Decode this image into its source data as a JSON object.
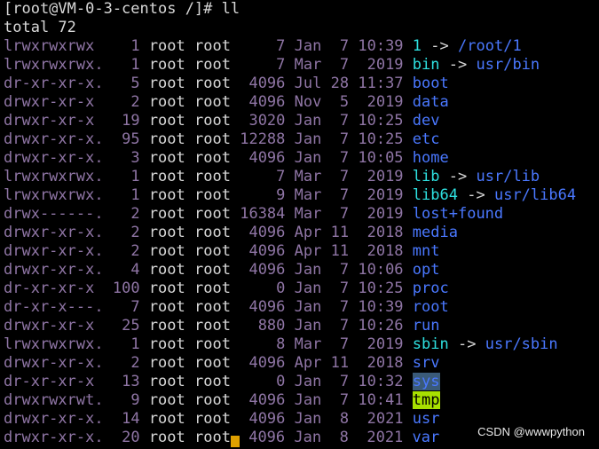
{
  "prompt": "[root@VM-0-3-centos /]# ll",
  "total": "total 72",
  "colors": {
    "perm": "#8f75a5",
    "dir": "#4a78ff",
    "link": "#2ee0e0",
    "highlight_sys": "#3a5a78",
    "highlight_tmp": "#a8e000",
    "cursor": "#e0a000"
  },
  "rows": [
    {
      "perm": "lrwxrwxrwx ",
      "links": "  1",
      "owner": "root",
      "group": "root",
      "size": "    7",
      "month": "Jan",
      "day": " 7",
      "time": "10:39",
      "name": "1",
      "kind": "link",
      "target": "/root/1"
    },
    {
      "perm": "lrwxrwxrwx.",
      "links": "  1",
      "owner": "root",
      "group": "root",
      "size": "    7",
      "month": "Mar",
      "day": " 7",
      "time": " 2019",
      "name": "bin",
      "kind": "link",
      "target": "usr/bin"
    },
    {
      "perm": "dr-xr-xr-x.",
      "links": "  5",
      "owner": "root",
      "group": "root",
      "size": " 4096",
      "month": "Jul",
      "day": "28",
      "time": "11:37",
      "name": "boot",
      "kind": "dir",
      "target": ""
    },
    {
      "perm": "drwxr-xr-x ",
      "links": "  2",
      "owner": "root",
      "group": "root",
      "size": " 4096",
      "month": "Nov",
      "day": " 5",
      "time": " 2019",
      "name": "data",
      "kind": "dir",
      "target": ""
    },
    {
      "perm": "drwxr-xr-x ",
      "links": " 19",
      "owner": "root",
      "group": "root",
      "size": " 3020",
      "month": "Jan",
      "day": " 7",
      "time": "10:25",
      "name": "dev",
      "kind": "dir",
      "target": ""
    },
    {
      "perm": "drwxr-xr-x.",
      "links": " 95",
      "owner": "root",
      "group": "root",
      "size": "12288",
      "month": "Jan",
      "day": " 7",
      "time": "10:25",
      "name": "etc",
      "kind": "dir",
      "target": ""
    },
    {
      "perm": "drwxr-xr-x.",
      "links": "  3",
      "owner": "root",
      "group": "root",
      "size": " 4096",
      "month": "Jan",
      "day": " 7",
      "time": "10:05",
      "name": "home",
      "kind": "dir",
      "target": ""
    },
    {
      "perm": "lrwxrwxrwx.",
      "links": "  1",
      "owner": "root",
      "group": "root",
      "size": "    7",
      "month": "Mar",
      "day": " 7",
      "time": " 2019",
      "name": "lib",
      "kind": "link",
      "target": "usr/lib"
    },
    {
      "perm": "lrwxrwxrwx.",
      "links": "  1",
      "owner": "root",
      "group": "root",
      "size": "    9",
      "month": "Mar",
      "day": " 7",
      "time": " 2019",
      "name": "lib64",
      "kind": "link",
      "target": "usr/lib64"
    },
    {
      "perm": "drwx------.",
      "links": "  2",
      "owner": "root",
      "group": "root",
      "size": "16384",
      "month": "Mar",
      "day": " 7",
      "time": " 2019",
      "name": "lost+found",
      "kind": "dir",
      "target": ""
    },
    {
      "perm": "drwxr-xr-x.",
      "links": "  2",
      "owner": "root",
      "group": "root",
      "size": " 4096",
      "month": "Apr",
      "day": "11",
      "time": " 2018",
      "name": "media",
      "kind": "dir",
      "target": ""
    },
    {
      "perm": "drwxr-xr-x.",
      "links": "  2",
      "owner": "root",
      "group": "root",
      "size": " 4096",
      "month": "Apr",
      "day": "11",
      "time": " 2018",
      "name": "mnt",
      "kind": "dir",
      "target": ""
    },
    {
      "perm": "drwxr-xr-x.",
      "links": "  4",
      "owner": "root",
      "group": "root",
      "size": " 4096",
      "month": "Jan",
      "day": " 7",
      "time": "10:06",
      "name": "opt",
      "kind": "dir",
      "target": ""
    },
    {
      "perm": "dr-xr-xr-x ",
      "links": "100",
      "owner": "root",
      "group": "root",
      "size": "    0",
      "month": "Jan",
      "day": " 7",
      "time": "10:25",
      "name": "proc",
      "kind": "dir",
      "target": ""
    },
    {
      "perm": "dr-xr-x---.",
      "links": "  7",
      "owner": "root",
      "group": "root",
      "size": " 4096",
      "month": "Jan",
      "day": " 7",
      "time": "10:39",
      "name": "root",
      "kind": "dir",
      "target": ""
    },
    {
      "perm": "drwxr-xr-x ",
      "links": " 25",
      "owner": "root",
      "group": "root",
      "size": "  880",
      "month": "Jan",
      "day": " 7",
      "time": "10:26",
      "name": "run",
      "kind": "dir",
      "target": ""
    },
    {
      "perm": "lrwxrwxrwx.",
      "links": "  1",
      "owner": "root",
      "group": "root",
      "size": "    8",
      "month": "Mar",
      "day": " 7",
      "time": " 2019",
      "name": "sbin",
      "kind": "link",
      "target": "usr/sbin"
    },
    {
      "perm": "drwxr-xr-x.",
      "links": "  2",
      "owner": "root",
      "group": "root",
      "size": " 4096",
      "month": "Apr",
      "day": "11",
      "time": " 2018",
      "name": "srv",
      "kind": "dir",
      "target": ""
    },
    {
      "perm": "dr-xr-xr-x ",
      "links": " 13",
      "owner": "root",
      "group": "root",
      "size": "    0",
      "month": "Jan",
      "day": " 7",
      "time": "10:32",
      "name": "sys",
      "kind": "sys",
      "target": ""
    },
    {
      "perm": "drwxrwxrwt.",
      "links": "  9",
      "owner": "root",
      "group": "root",
      "size": " 4096",
      "month": "Jan",
      "day": " 7",
      "time": "10:41",
      "name": "tmp",
      "kind": "tmp",
      "target": ""
    },
    {
      "perm": "drwxr-xr-x.",
      "links": " 14",
      "owner": "root",
      "group": "root",
      "size": " 4096",
      "month": "Jan",
      "day": " 8",
      "time": " 2021",
      "name": "usr",
      "kind": "dir",
      "target": ""
    },
    {
      "perm": "drwxr-xr-x.",
      "links": " 20",
      "owner": "root",
      "group": "root",
      "size": " 4096",
      "month": "Jan",
      "day": " 8",
      "time": " 2021",
      "name": "var",
      "kind": "dir",
      "target": ""
    }
  ],
  "arrow": "->",
  "watermark": "CSDN @wwwpython"
}
